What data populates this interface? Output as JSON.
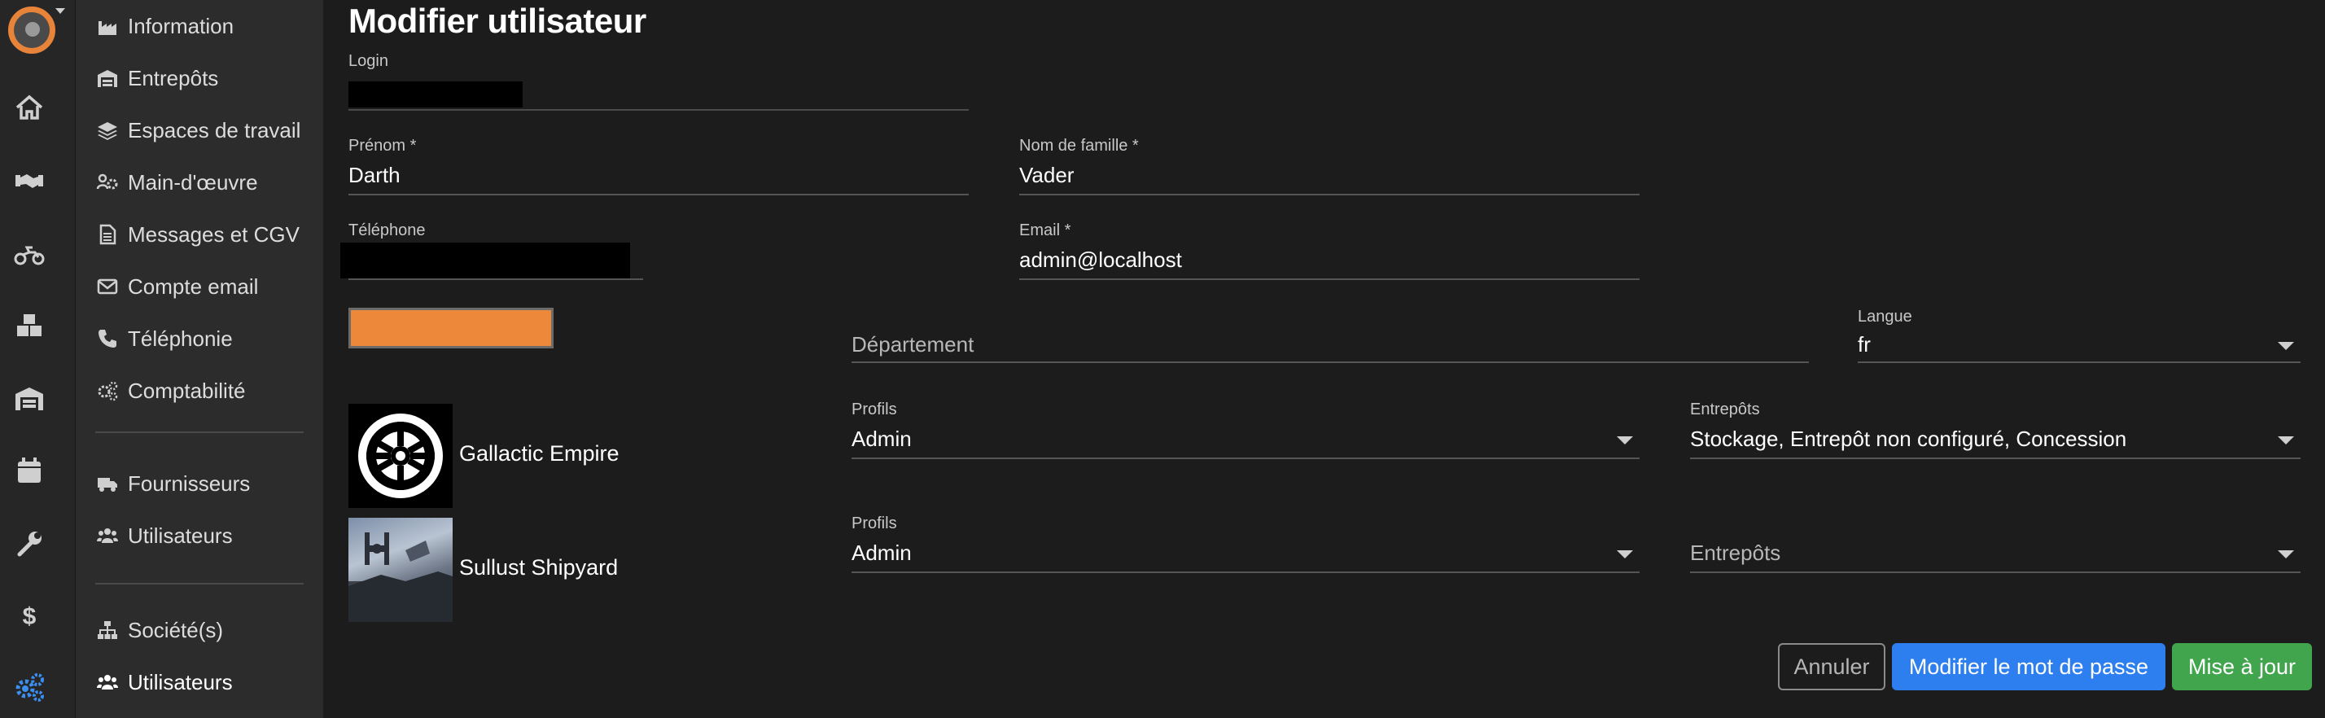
{
  "rail": {
    "icons": [
      "avatar",
      "home-icon",
      "handshake-icon",
      "motorcycle-icon",
      "boxes-icon",
      "warehouse-icon",
      "calendar-icon",
      "wrench-icon",
      "dollar-icon",
      "cogs-icon"
    ],
    "active_color": "#3b8ff0"
  },
  "sidebar": {
    "items": [
      {
        "label": "Information",
        "icon": "industry-icon"
      },
      {
        "label": "Entrepôts",
        "icon": "warehouse-icon"
      },
      {
        "label": "Espaces de travail",
        "icon": "layers-icon"
      },
      {
        "label": "Main-d'œuvre",
        "icon": "users-cog-icon"
      },
      {
        "label": "Messages et CGV",
        "icon": "file-text-icon"
      },
      {
        "label": "Compte email",
        "icon": "envelope-icon"
      },
      {
        "label": "Téléphonie",
        "icon": "phone-icon"
      },
      {
        "label": "Comptabilité",
        "icon": "cogs-icon"
      }
    ],
    "group2": [
      {
        "label": "Fournisseurs",
        "icon": "truck-icon"
      },
      {
        "label": "Utilisateurs",
        "icon": "users-icon"
      }
    ],
    "group3": [
      {
        "label": "Société(s)",
        "icon": "sitemap-icon"
      },
      {
        "label": "Utilisateurs",
        "icon": "users-icon"
      }
    ]
  },
  "page": {
    "title": "Modifier utilisateur"
  },
  "form": {
    "login": {
      "label": "Login",
      "value": ""
    },
    "firstname": {
      "label": "Prénom *",
      "value": "Darth"
    },
    "lastname": {
      "label": "Nom de famille *",
      "value": "Vader"
    },
    "phone": {
      "label": "Téléphone",
      "value": ""
    },
    "email": {
      "label": "Email *",
      "value": "admin@localhost"
    },
    "color": "#ed8739",
    "department": {
      "placeholder": "Département",
      "value": ""
    },
    "language": {
      "label": "Langue",
      "value": "fr"
    }
  },
  "companies": [
    {
      "name": "Gallactic Empire",
      "profiles_label": "Profils",
      "profiles_value": "Admin",
      "warehouses_label": "Entrepôts",
      "warehouses_value": "Stockage, Entrepôt non configuré, Concession"
    },
    {
      "name": "Sullust Shipyard",
      "profiles_label": "Profils",
      "profiles_value": "Admin",
      "warehouses_placeholder": "Entrepôts"
    }
  ],
  "buttons": {
    "cancel": "Annuler",
    "change_password": "Modifier le mot de passe",
    "update": "Mise à jour"
  }
}
